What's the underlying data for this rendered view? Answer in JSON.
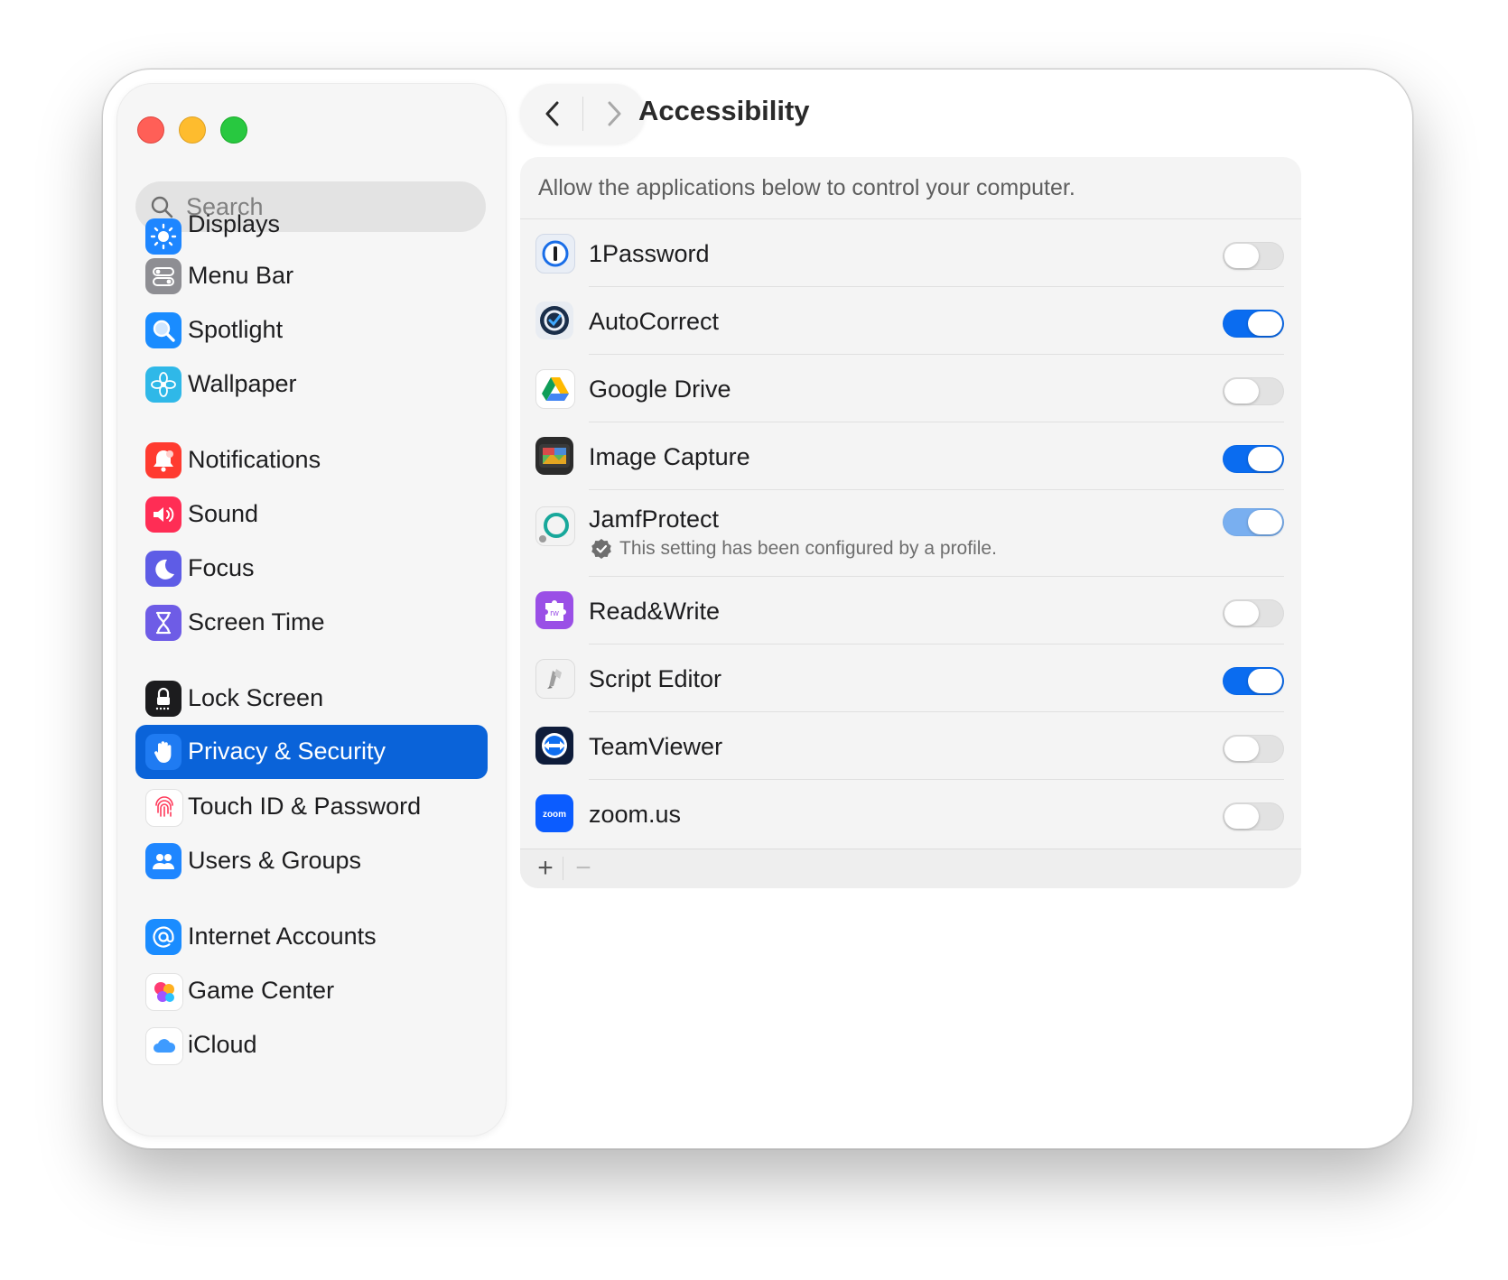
{
  "sidebar": {
    "search_placeholder": "Search",
    "items": [
      {
        "label": "Displays",
        "icon": "sun-icon"
      },
      {
        "label": "Menu Bar",
        "icon": "menu-bar-icon"
      },
      {
        "label": "Spotlight",
        "icon": "magnifier-icon"
      },
      {
        "label": "Wallpaper",
        "icon": "flower-icon"
      },
      {
        "label": "Notifications",
        "icon": "bell-icon"
      },
      {
        "label": "Sound",
        "icon": "speaker-icon"
      },
      {
        "label": "Focus",
        "icon": "moon-icon"
      },
      {
        "label": "Screen Time",
        "icon": "hourglass-icon"
      },
      {
        "label": "Lock Screen",
        "icon": "lock-icon"
      },
      {
        "label": "Privacy & Security",
        "icon": "hand-icon",
        "selected": true
      },
      {
        "label": "Touch ID & Password",
        "icon": "fingerprint-icon"
      },
      {
        "label": "Users & Groups",
        "icon": "users-icon"
      },
      {
        "label": "Internet Accounts",
        "icon": "at-sign-icon"
      },
      {
        "label": "Game Center",
        "icon": "game-center-icon"
      },
      {
        "label": "iCloud",
        "icon": "cloud-icon"
      }
    ]
  },
  "header": {
    "title": "Accessibility"
  },
  "panel": {
    "description": "Allow the applications below to control your computer.",
    "apps": [
      {
        "name": "1Password",
        "enabled": false,
        "icon": "onepassword-icon"
      },
      {
        "name": "AutoCorrect",
        "enabled": true,
        "icon": "autocorrect-icon"
      },
      {
        "name": "Google Drive",
        "enabled": false,
        "icon": "google-drive-icon"
      },
      {
        "name": "Image Capture",
        "enabled": true,
        "icon": "image-capture-icon"
      },
      {
        "name": "JamfProtect",
        "enabled": true,
        "managed": true,
        "subtitle": "This setting has been configured by a profile.",
        "icon": "jamf-protect-icon"
      },
      {
        "name": "Read&Write",
        "enabled": false,
        "icon": "read-write-icon"
      },
      {
        "name": "Script Editor",
        "enabled": true,
        "icon": "script-editor-icon"
      },
      {
        "name": "TeamViewer",
        "enabled": false,
        "icon": "teamviewer-icon"
      },
      {
        "name": "zoom.us",
        "enabled": false,
        "icon": "zoom-icon"
      }
    ],
    "footer": {
      "add_label": "+",
      "remove_label": "−"
    }
  },
  "icon_labels": {
    "read_write": "rw",
    "zoom": "zoom"
  },
  "colors": {
    "accent": "#0a63d9",
    "toggle_on": "#0a6cf0",
    "toggle_managed": "#79aff0"
  }
}
